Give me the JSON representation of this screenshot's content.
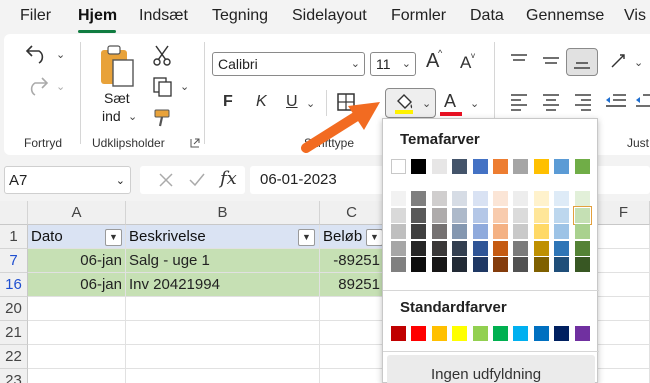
{
  "menu": {
    "tabs": [
      "Filer",
      "Hjem",
      "Indsæt",
      "Tegning",
      "Sidelayout",
      "Formler",
      "Data",
      "Gennemse",
      "Vis"
    ]
  },
  "ribbon": {
    "groups": {
      "undo": "Fortryd",
      "clipboard": "Udklipsholder",
      "font": "Skrifttype",
      "alignment": "Just"
    },
    "paste": {
      "line1": "Sæt",
      "line2": "ind"
    },
    "font_name": "Calibri",
    "font_size": "11",
    "bold": "F",
    "italic": "K",
    "underline": "U",
    "grow_font": "A",
    "shrink_font": "A",
    "font_color_letter": "A"
  },
  "formula_bar": {
    "name_box": "A7",
    "fx_label": "fx",
    "formula": "06-01-2023"
  },
  "sheet": {
    "columns": [
      "A",
      "B",
      "C",
      "F"
    ],
    "header_row": {
      "row": "1",
      "cells": [
        "Dato",
        "Beskrivelse",
        "Beløb"
      ]
    },
    "rows": [
      {
        "row": "7",
        "cells": [
          "06-jan",
          "Salg - uge 1",
          "-89251"
        ]
      },
      {
        "row": "16",
        "cells": [
          "06-jan",
          "Inv 20421994",
          "89251"
        ]
      },
      {
        "row": "20",
        "cells": [
          "",
          "",
          ""
        ]
      },
      {
        "row": "21",
        "cells": [
          "",
          "",
          ""
        ]
      },
      {
        "row": "22",
        "cells": [
          "",
          "",
          ""
        ]
      },
      {
        "row": "23",
        "cells": [
          "",
          "",
          ""
        ]
      }
    ]
  },
  "colors": {
    "accent": "#107c41",
    "fill_bar": "#fff200",
    "font_color_bar": "#e81123",
    "header_fill": "#dae3f3",
    "row_fill": "#c6e0b4",
    "arrow": "#f26b21"
  },
  "fill_dropdown": {
    "theme_title": "Temafarver",
    "standard_title": "Standardfarver",
    "no_fill": "Ingen udfyldning",
    "theme_top": [
      "#ffffff",
      "#000000",
      "#e7e6e6",
      "#44546a",
      "#4472c4",
      "#ed7d31",
      "#a5a5a5",
      "#ffc000",
      "#5b9bd5",
      "#70ad47"
    ],
    "theme_shades": [
      [
        "#f2f2f2",
        "#7f7f7f",
        "#d0cece",
        "#d6dce5",
        "#d9e2f3",
        "#fbe5d6",
        "#ededed",
        "#fff2cc",
        "#deebf7",
        "#e2f0d9"
      ],
      [
        "#d9d9d9",
        "#595959",
        "#aeabab",
        "#adb9ca",
        "#b4c7e7",
        "#f8cbad",
        "#dbdbdb",
        "#ffe699",
        "#bdd7ee",
        "#c5e0b4"
      ],
      [
        "#bfbfbf",
        "#404040",
        "#757171",
        "#8497b0",
        "#8faadc",
        "#f4b183",
        "#c9c9c9",
        "#ffd966",
        "#9dc3e6",
        "#a9d18e"
      ],
      [
        "#a6a6a6",
        "#262626",
        "#3a3838",
        "#333f50",
        "#2f5597",
        "#c55a11",
        "#7b7b7b",
        "#bf9000",
        "#2e75b6",
        "#548235"
      ],
      [
        "#808080",
        "#0d0d0d",
        "#171616",
        "#222a35",
        "#1f3864",
        "#843c0c",
        "#525252",
        "#7f6000",
        "#1f4e79",
        "#385723"
      ]
    ],
    "standard": [
      "#c00000",
      "#ff0000",
      "#ffc000",
      "#ffff00",
      "#92d050",
      "#00b050",
      "#00b0f0",
      "#0070c0",
      "#002060",
      "#7030a0"
    ]
  },
  "icons": [
    "undo-icon",
    "redo-icon",
    "paste-icon",
    "cut-icon",
    "copy-icon",
    "format-painter-icon",
    "borders-icon",
    "fill-color-icon",
    "font-color-icon",
    "align-top-icon",
    "align-middle-icon",
    "align-bottom-icon",
    "align-left-icon",
    "align-center-icon",
    "align-right-icon",
    "indent-icon",
    "orientation-icon",
    "dialog-launcher-icon",
    "cancel-icon",
    "enter-icon",
    "filter-dropdown-icon"
  ]
}
